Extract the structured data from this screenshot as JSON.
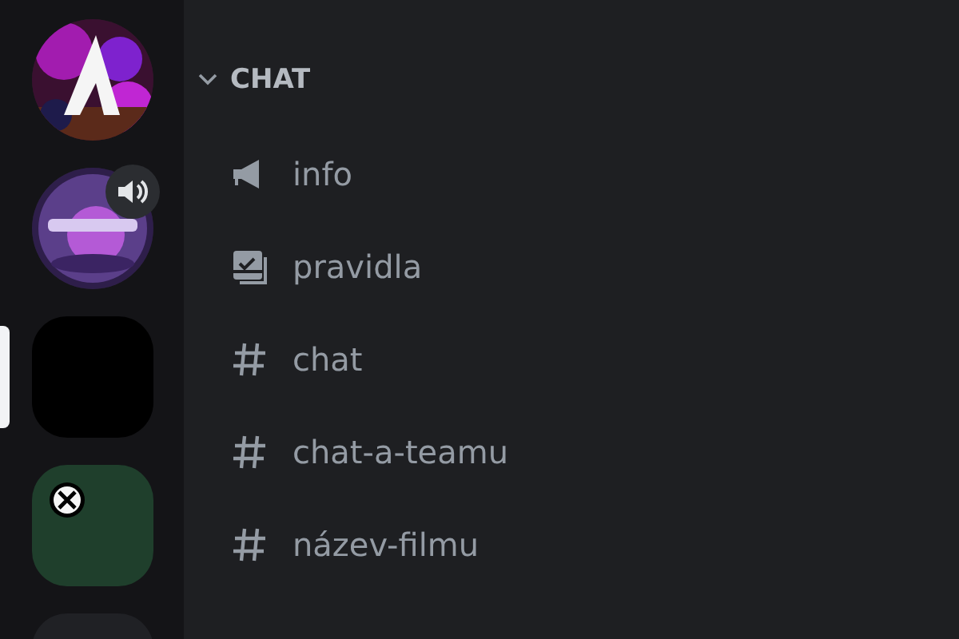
{
  "servers": [
    {
      "kind": "picture",
      "selected": false,
      "speaker": false,
      "emblem": false
    },
    {
      "kind": "picture",
      "selected": false,
      "speaker": true,
      "emblem": false
    },
    {
      "kind": "plain",
      "color": "#000000",
      "selected": true,
      "speaker": false,
      "emblem": false
    },
    {
      "kind": "plain",
      "color": "#1f3f2c",
      "selected": false,
      "speaker": false,
      "emblem": true
    },
    {
      "kind": "plain",
      "color": "#202125",
      "selected": false,
      "speaker": false,
      "emblem": false
    }
  ],
  "category": {
    "name": "CHAT",
    "expanded": true
  },
  "channels": [
    {
      "kind": "announcement",
      "name": "info"
    },
    {
      "kind": "rules",
      "name": "pravidla"
    },
    {
      "kind": "text",
      "name": "chat"
    },
    {
      "kind": "text",
      "name": "chat-a-teamu"
    },
    {
      "kind": "text",
      "name": "název-filmu"
    }
  ]
}
